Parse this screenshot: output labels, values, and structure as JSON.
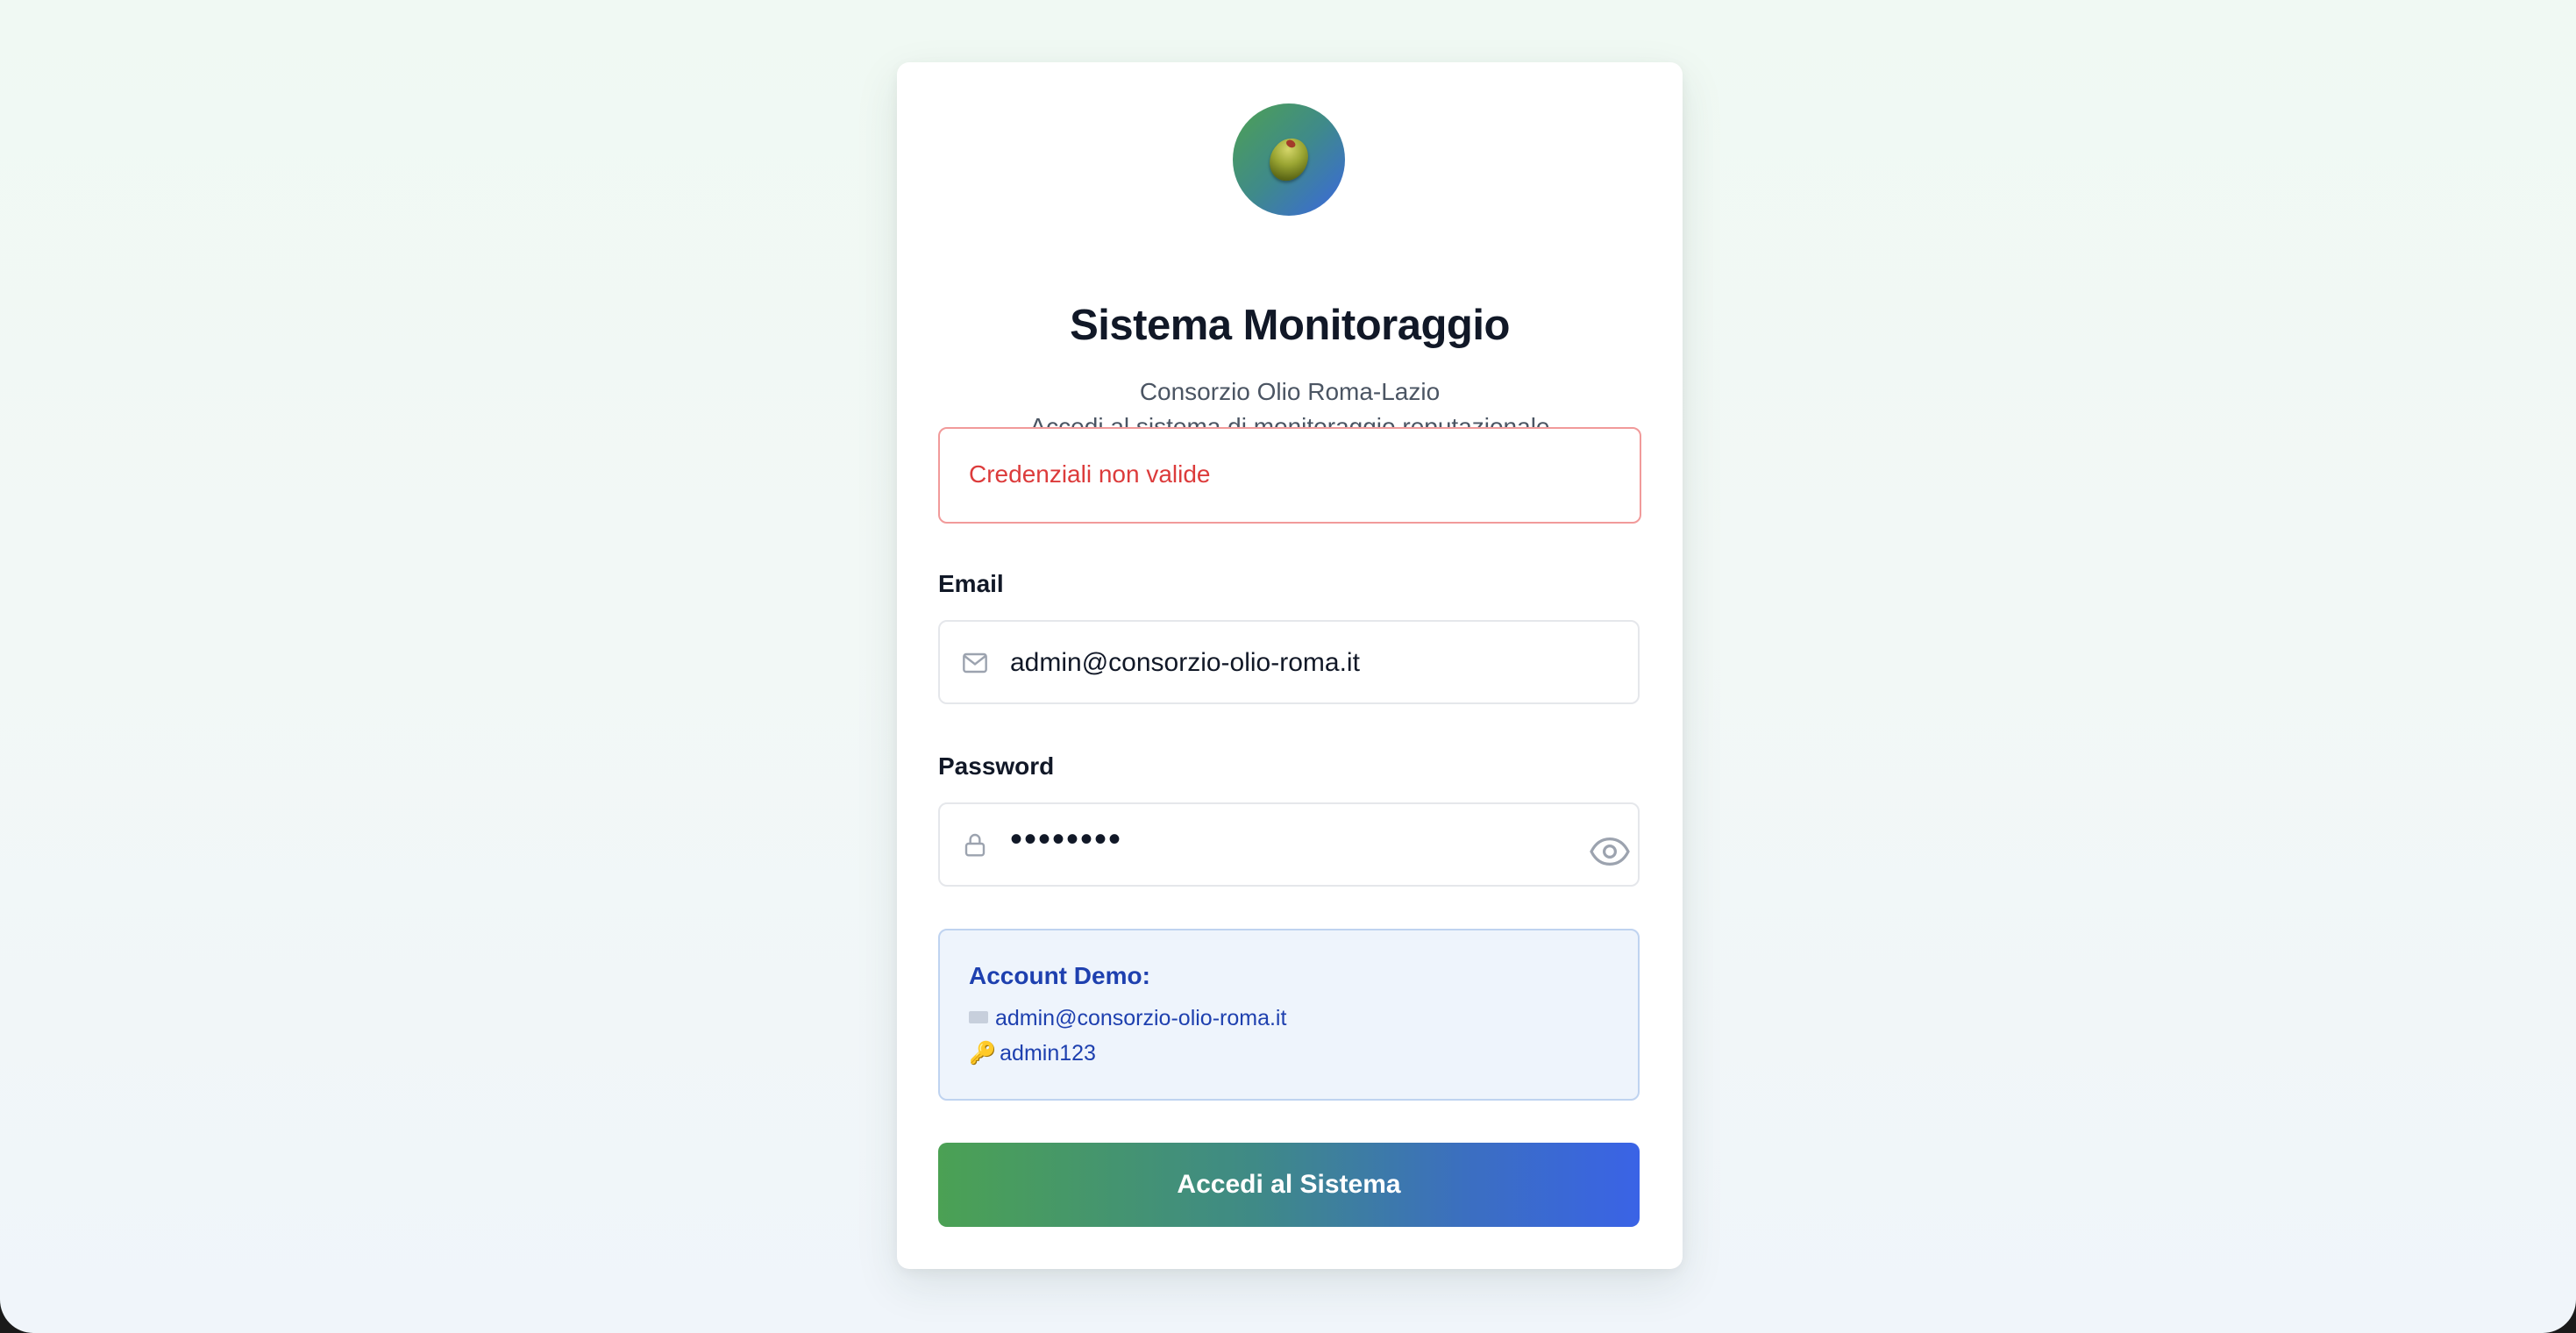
{
  "header": {
    "title": "Sistema Monitoraggio",
    "subtitle_line1": "Consorzio Olio Roma-Lazio",
    "subtitle_line2": "Accedi al sistema di monitoraggio reputazionale"
  },
  "alert": {
    "message": "Credenziali non valide"
  },
  "form": {
    "email_label": "Email",
    "email_value": "admin@consorzio-olio-roma.it",
    "password_label": "Password",
    "password_masked": "••••••••"
  },
  "demo": {
    "title": "Account Demo:",
    "email": "admin@consorzio-olio-roma.it",
    "password": "admin123"
  },
  "actions": {
    "submit_label": "Accedi al Sistema"
  },
  "icons": {
    "logo": "olive-icon",
    "email": "mail-icon",
    "password": "lock-icon",
    "toggle": "eye-icon",
    "demo_email": "mail-icon",
    "demo_password": "key-icon"
  },
  "colors": {
    "error": "#dc3b3b",
    "demo_text": "#1e40af",
    "gradient_start": "#4ba154",
    "gradient_end": "#3a63e6"
  }
}
